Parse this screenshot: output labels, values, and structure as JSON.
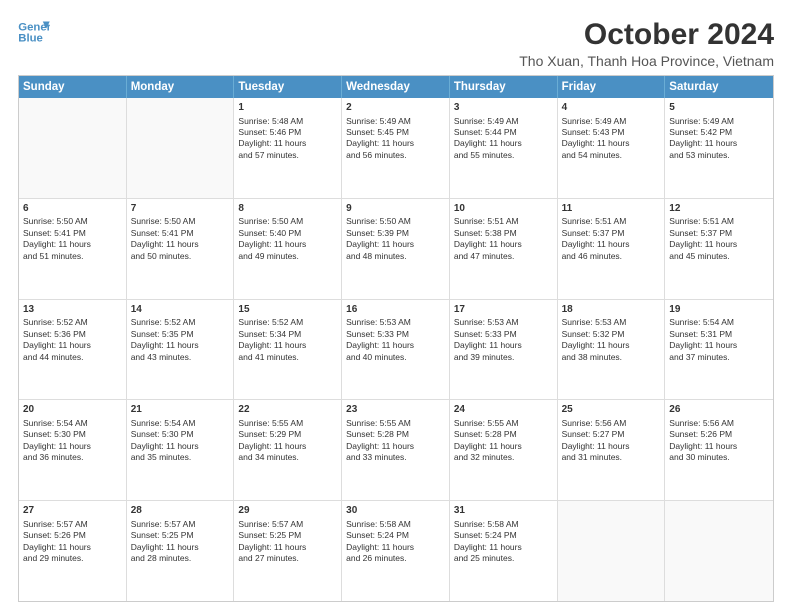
{
  "logo": {
    "line1": "General",
    "line2": "Blue"
  },
  "title": "October 2024",
  "subtitle": "Tho Xuan, Thanh Hoa Province, Vietnam",
  "header_days": [
    "Sunday",
    "Monday",
    "Tuesday",
    "Wednesday",
    "Thursday",
    "Friday",
    "Saturday"
  ],
  "rows": [
    [
      {
        "num": "",
        "lines": [],
        "empty": true
      },
      {
        "num": "",
        "lines": [],
        "empty": true
      },
      {
        "num": "1",
        "lines": [
          "Sunrise: 5:48 AM",
          "Sunset: 5:46 PM",
          "Daylight: 11 hours",
          "and 57 minutes."
        ]
      },
      {
        "num": "2",
        "lines": [
          "Sunrise: 5:49 AM",
          "Sunset: 5:45 PM",
          "Daylight: 11 hours",
          "and 56 minutes."
        ]
      },
      {
        "num": "3",
        "lines": [
          "Sunrise: 5:49 AM",
          "Sunset: 5:44 PM",
          "Daylight: 11 hours",
          "and 55 minutes."
        ]
      },
      {
        "num": "4",
        "lines": [
          "Sunrise: 5:49 AM",
          "Sunset: 5:43 PM",
          "Daylight: 11 hours",
          "and 54 minutes."
        ]
      },
      {
        "num": "5",
        "lines": [
          "Sunrise: 5:49 AM",
          "Sunset: 5:42 PM",
          "Daylight: 11 hours",
          "and 53 minutes."
        ]
      }
    ],
    [
      {
        "num": "6",
        "lines": [
          "Sunrise: 5:50 AM",
          "Sunset: 5:41 PM",
          "Daylight: 11 hours",
          "and 51 minutes."
        ]
      },
      {
        "num": "7",
        "lines": [
          "Sunrise: 5:50 AM",
          "Sunset: 5:41 PM",
          "Daylight: 11 hours",
          "and 50 minutes."
        ]
      },
      {
        "num": "8",
        "lines": [
          "Sunrise: 5:50 AM",
          "Sunset: 5:40 PM",
          "Daylight: 11 hours",
          "and 49 minutes."
        ]
      },
      {
        "num": "9",
        "lines": [
          "Sunrise: 5:50 AM",
          "Sunset: 5:39 PM",
          "Daylight: 11 hours",
          "and 48 minutes."
        ]
      },
      {
        "num": "10",
        "lines": [
          "Sunrise: 5:51 AM",
          "Sunset: 5:38 PM",
          "Daylight: 11 hours",
          "and 47 minutes."
        ]
      },
      {
        "num": "11",
        "lines": [
          "Sunrise: 5:51 AM",
          "Sunset: 5:37 PM",
          "Daylight: 11 hours",
          "and 46 minutes."
        ]
      },
      {
        "num": "12",
        "lines": [
          "Sunrise: 5:51 AM",
          "Sunset: 5:37 PM",
          "Daylight: 11 hours",
          "and 45 minutes."
        ]
      }
    ],
    [
      {
        "num": "13",
        "lines": [
          "Sunrise: 5:52 AM",
          "Sunset: 5:36 PM",
          "Daylight: 11 hours",
          "and 44 minutes."
        ]
      },
      {
        "num": "14",
        "lines": [
          "Sunrise: 5:52 AM",
          "Sunset: 5:35 PM",
          "Daylight: 11 hours",
          "and 43 minutes."
        ]
      },
      {
        "num": "15",
        "lines": [
          "Sunrise: 5:52 AM",
          "Sunset: 5:34 PM",
          "Daylight: 11 hours",
          "and 41 minutes."
        ]
      },
      {
        "num": "16",
        "lines": [
          "Sunrise: 5:53 AM",
          "Sunset: 5:33 PM",
          "Daylight: 11 hours",
          "and 40 minutes."
        ]
      },
      {
        "num": "17",
        "lines": [
          "Sunrise: 5:53 AM",
          "Sunset: 5:33 PM",
          "Daylight: 11 hours",
          "and 39 minutes."
        ]
      },
      {
        "num": "18",
        "lines": [
          "Sunrise: 5:53 AM",
          "Sunset: 5:32 PM",
          "Daylight: 11 hours",
          "and 38 minutes."
        ]
      },
      {
        "num": "19",
        "lines": [
          "Sunrise: 5:54 AM",
          "Sunset: 5:31 PM",
          "Daylight: 11 hours",
          "and 37 minutes."
        ]
      }
    ],
    [
      {
        "num": "20",
        "lines": [
          "Sunrise: 5:54 AM",
          "Sunset: 5:30 PM",
          "Daylight: 11 hours",
          "and 36 minutes."
        ]
      },
      {
        "num": "21",
        "lines": [
          "Sunrise: 5:54 AM",
          "Sunset: 5:30 PM",
          "Daylight: 11 hours",
          "and 35 minutes."
        ]
      },
      {
        "num": "22",
        "lines": [
          "Sunrise: 5:55 AM",
          "Sunset: 5:29 PM",
          "Daylight: 11 hours",
          "and 34 minutes."
        ]
      },
      {
        "num": "23",
        "lines": [
          "Sunrise: 5:55 AM",
          "Sunset: 5:28 PM",
          "Daylight: 11 hours",
          "and 33 minutes."
        ]
      },
      {
        "num": "24",
        "lines": [
          "Sunrise: 5:55 AM",
          "Sunset: 5:28 PM",
          "Daylight: 11 hours",
          "and 32 minutes."
        ]
      },
      {
        "num": "25",
        "lines": [
          "Sunrise: 5:56 AM",
          "Sunset: 5:27 PM",
          "Daylight: 11 hours",
          "and 31 minutes."
        ]
      },
      {
        "num": "26",
        "lines": [
          "Sunrise: 5:56 AM",
          "Sunset: 5:26 PM",
          "Daylight: 11 hours",
          "and 30 minutes."
        ]
      }
    ],
    [
      {
        "num": "27",
        "lines": [
          "Sunrise: 5:57 AM",
          "Sunset: 5:26 PM",
          "Daylight: 11 hours",
          "and 29 minutes."
        ]
      },
      {
        "num": "28",
        "lines": [
          "Sunrise: 5:57 AM",
          "Sunset: 5:25 PM",
          "Daylight: 11 hours",
          "and 28 minutes."
        ]
      },
      {
        "num": "29",
        "lines": [
          "Sunrise: 5:57 AM",
          "Sunset: 5:25 PM",
          "Daylight: 11 hours",
          "and 27 minutes."
        ]
      },
      {
        "num": "30",
        "lines": [
          "Sunrise: 5:58 AM",
          "Sunset: 5:24 PM",
          "Daylight: 11 hours",
          "and 26 minutes."
        ]
      },
      {
        "num": "31",
        "lines": [
          "Sunrise: 5:58 AM",
          "Sunset: 5:24 PM",
          "Daylight: 11 hours",
          "and 25 minutes."
        ]
      },
      {
        "num": "",
        "lines": [],
        "empty": true
      },
      {
        "num": "",
        "lines": [],
        "empty": true
      }
    ]
  ]
}
